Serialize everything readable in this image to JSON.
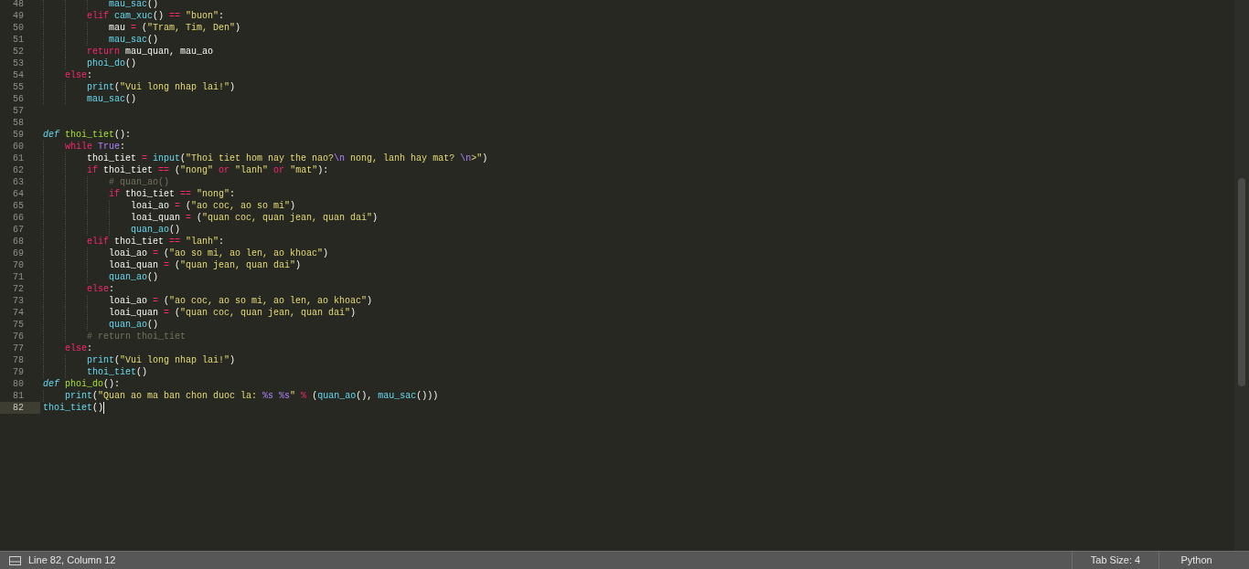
{
  "editor": {
    "lines": [
      {
        "number": "48",
        "current": false,
        "tokens": [
          {
            "kind": "call",
            "text": "            mau_sac"
          },
          {
            "kind": "plain",
            "text": "()"
          }
        ]
      },
      {
        "number": "49",
        "current": false,
        "tokens": [
          {
            "kind": "keyword",
            "text": "        elif "
          },
          {
            "kind": "call",
            "text": "cam_xuc"
          },
          {
            "kind": "plain",
            "text": "() "
          },
          {
            "kind": "operator",
            "text": "== "
          },
          {
            "kind": "string",
            "text": "\"buon\""
          },
          {
            "kind": "plain",
            "text": ":"
          }
        ]
      },
      {
        "number": "50",
        "current": false,
        "tokens": [
          {
            "kind": "plain",
            "text": "            mau "
          },
          {
            "kind": "operator",
            "text": "="
          },
          {
            "kind": "plain",
            "text": " ("
          },
          {
            "kind": "string",
            "text": "\"Tram, Tim, Den\""
          },
          {
            "kind": "plain",
            "text": ")"
          }
        ]
      },
      {
        "number": "51",
        "current": false,
        "tokens": [
          {
            "kind": "call",
            "text": "            mau_sac"
          },
          {
            "kind": "plain",
            "text": "()"
          }
        ]
      },
      {
        "number": "52",
        "current": false,
        "tokens": [
          {
            "kind": "keyword",
            "text": "        return"
          },
          {
            "kind": "plain",
            "text": " mau_quan, mau_ao"
          }
        ]
      },
      {
        "number": "53",
        "current": false,
        "tokens": [
          {
            "kind": "call",
            "text": "        phoi_do"
          },
          {
            "kind": "plain",
            "text": "()"
          }
        ]
      },
      {
        "number": "54",
        "current": false,
        "tokens": [
          {
            "kind": "keyword",
            "text": "    else"
          },
          {
            "kind": "plain",
            "text": ":"
          }
        ]
      },
      {
        "number": "55",
        "current": false,
        "tokens": [
          {
            "kind": "call",
            "text": "        print"
          },
          {
            "kind": "plain",
            "text": "("
          },
          {
            "kind": "string",
            "text": "\"Vui long nhap lai!\""
          },
          {
            "kind": "plain",
            "text": ")"
          }
        ]
      },
      {
        "number": "56",
        "current": false,
        "tokens": [
          {
            "kind": "call",
            "text": "        mau_sac"
          },
          {
            "kind": "plain",
            "text": "()"
          }
        ]
      },
      {
        "number": "57",
        "current": false
      },
      {
        "number": "58",
        "current": false
      },
      {
        "number": "59",
        "current": false,
        "tokens": [
          {
            "kind": "storage",
            "text": "def "
          },
          {
            "kind": "name",
            "text": "thoi_tiet"
          },
          {
            "kind": "plain",
            "text": "():"
          }
        ]
      },
      {
        "number": "60",
        "current": false,
        "tokens": [
          {
            "kind": "keyword",
            "text": "    while "
          },
          {
            "kind": "constant",
            "text": "True"
          },
          {
            "kind": "plain",
            "text": ":"
          }
        ]
      },
      {
        "number": "61",
        "current": false,
        "tokens": [
          {
            "kind": "plain",
            "text": "        thoi_tiet "
          },
          {
            "kind": "operator",
            "text": "= "
          },
          {
            "kind": "call",
            "text": "input"
          },
          {
            "kind": "plain",
            "text": "("
          },
          {
            "kind": "string",
            "text": "\"Thoi tiet hom nay the nao?"
          },
          {
            "kind": "constant",
            "text": "\\n"
          },
          {
            "kind": "string",
            "text": " nong, lanh hay mat? "
          },
          {
            "kind": "constant",
            "text": "\\n"
          },
          {
            "kind": "string",
            "text": ">\""
          },
          {
            "kind": "plain",
            "text": ")"
          }
        ]
      },
      {
        "number": "62",
        "current": false,
        "tokens": [
          {
            "kind": "keyword",
            "text": "        if"
          },
          {
            "kind": "plain",
            "text": " thoi_tiet "
          },
          {
            "kind": "operator",
            "text": "=="
          },
          {
            "kind": "plain",
            "text": " ("
          },
          {
            "kind": "string",
            "text": "\"nong\" "
          },
          {
            "kind": "operator",
            "text": "or "
          },
          {
            "kind": "string",
            "text": "\"lanh\" "
          },
          {
            "kind": "operator",
            "text": "or "
          },
          {
            "kind": "string",
            "text": "\"mat\""
          },
          {
            "kind": "plain",
            "text": "):"
          }
        ]
      },
      {
        "number": "63",
        "current": false,
        "tokens": [
          {
            "kind": "comment",
            "text": "            # quan_ao()"
          }
        ]
      },
      {
        "number": "64",
        "current": false,
        "tokens": [
          {
            "kind": "keyword",
            "text": "            if"
          },
          {
            "kind": "plain",
            "text": " thoi_tiet "
          },
          {
            "kind": "operator",
            "text": "== "
          },
          {
            "kind": "string",
            "text": "\"nong\""
          },
          {
            "kind": "plain",
            "text": ":"
          }
        ]
      },
      {
        "number": "65",
        "current": false,
        "tokens": [
          {
            "kind": "plain",
            "text": "                loai_ao "
          },
          {
            "kind": "operator",
            "text": "="
          },
          {
            "kind": "plain",
            "text": " ("
          },
          {
            "kind": "string",
            "text": "\"ao coc, ao so mi\""
          },
          {
            "kind": "plain",
            "text": ")"
          }
        ]
      },
      {
        "number": "66",
        "current": false,
        "tokens": [
          {
            "kind": "plain",
            "text": "                loai_quan "
          },
          {
            "kind": "operator",
            "text": "="
          },
          {
            "kind": "plain",
            "text": " ("
          },
          {
            "kind": "string",
            "text": "\"quan coc, quan jean, quan dai\""
          },
          {
            "kind": "plain",
            "text": ")"
          }
        ]
      },
      {
        "number": "67",
        "current": false,
        "tokens": [
          {
            "kind": "call",
            "text": "                quan_ao"
          },
          {
            "kind": "plain",
            "text": "()"
          }
        ]
      },
      {
        "number": "68",
        "current": false,
        "tokens": [
          {
            "kind": "keyword",
            "text": "        elif"
          },
          {
            "kind": "plain",
            "text": " thoi_tiet "
          },
          {
            "kind": "operator",
            "text": "== "
          },
          {
            "kind": "string",
            "text": "\"lanh\""
          },
          {
            "kind": "plain",
            "text": ":"
          }
        ]
      },
      {
        "number": "69",
        "current": false,
        "tokens": [
          {
            "kind": "plain",
            "text": "            loai_ao "
          },
          {
            "kind": "operator",
            "text": "="
          },
          {
            "kind": "plain",
            "text": " ("
          },
          {
            "kind": "string",
            "text": "\"ao so mi, ao len, ao khoac\""
          },
          {
            "kind": "plain",
            "text": ")"
          }
        ]
      },
      {
        "number": "70",
        "current": false,
        "tokens": [
          {
            "kind": "plain",
            "text": "            loai_quan "
          },
          {
            "kind": "operator",
            "text": "="
          },
          {
            "kind": "plain",
            "text": " ("
          },
          {
            "kind": "string",
            "text": "\"quan jean, quan dai\""
          },
          {
            "kind": "plain",
            "text": ")"
          }
        ]
      },
      {
        "number": "71",
        "current": false,
        "tokens": [
          {
            "kind": "call",
            "text": "            quan_ao"
          },
          {
            "kind": "plain",
            "text": "()"
          }
        ]
      },
      {
        "number": "72",
        "current": false,
        "tokens": [
          {
            "kind": "keyword",
            "text": "        else"
          },
          {
            "kind": "plain",
            "text": ":"
          }
        ]
      },
      {
        "number": "73",
        "current": false,
        "tokens": [
          {
            "kind": "plain",
            "text": "            loai_ao "
          },
          {
            "kind": "operator",
            "text": "="
          },
          {
            "kind": "plain",
            "text": " ("
          },
          {
            "kind": "string",
            "text": "\"ao coc, ao so mi, ao len, ao khoac\""
          },
          {
            "kind": "plain",
            "text": ")"
          }
        ]
      },
      {
        "number": "74",
        "current": false,
        "tokens": [
          {
            "kind": "plain",
            "text": "            loai_quan "
          },
          {
            "kind": "operator",
            "text": "="
          },
          {
            "kind": "plain",
            "text": " ("
          },
          {
            "kind": "string",
            "text": "\"quan coc, quan jean, quan dai\""
          },
          {
            "kind": "plain",
            "text": ")"
          }
        ]
      },
      {
        "number": "75",
        "current": false,
        "tokens": [
          {
            "kind": "call",
            "text": "            quan_ao"
          },
          {
            "kind": "plain",
            "text": "()"
          }
        ]
      },
      {
        "number": "76",
        "current": false,
        "tokens": [
          {
            "kind": "comment",
            "text": "        # return thoi_tiet"
          }
        ]
      },
      {
        "number": "77",
        "current": false,
        "tokens": [
          {
            "kind": "keyword",
            "text": "    else"
          },
          {
            "kind": "plain",
            "text": ":"
          }
        ]
      },
      {
        "number": "78",
        "current": false,
        "tokens": [
          {
            "kind": "call",
            "text": "        print"
          },
          {
            "kind": "plain",
            "text": "("
          },
          {
            "kind": "string",
            "text": "\"Vui long nhap lai!\""
          },
          {
            "kind": "plain",
            "text": ")"
          }
        ]
      },
      {
        "number": "79",
        "current": false,
        "tokens": [
          {
            "kind": "call",
            "text": "        thoi_tiet"
          },
          {
            "kind": "plain",
            "text": "()"
          }
        ]
      },
      {
        "number": "80",
        "current": false,
        "tokens": [
          {
            "kind": "storage",
            "text": "def "
          },
          {
            "kind": "name",
            "text": "phoi_do"
          },
          {
            "kind": "plain",
            "text": "():"
          }
        ]
      },
      {
        "number": "81",
        "current": false,
        "tokens": [
          {
            "kind": "call",
            "text": "    print"
          },
          {
            "kind": "plain",
            "text": "("
          },
          {
            "kind": "string",
            "text": "\"Quan ao ma ban chon duoc la: "
          },
          {
            "kind": "constant",
            "text": "%s "
          },
          {
            "kind": "constant",
            "text": "%s"
          },
          {
            "kind": "string",
            "text": "\" "
          },
          {
            "kind": "operator",
            "text": "%"
          },
          {
            "kind": "plain",
            "text": " ("
          },
          {
            "kind": "call",
            "text": "quan_ao"
          },
          {
            "kind": "plain",
            "text": "(), "
          },
          {
            "kind": "call",
            "text": "mau_sac"
          },
          {
            "kind": "plain",
            "text": "()))"
          }
        ]
      },
      {
        "number": "82",
        "current": true,
        "tokens": [
          {
            "kind": "call",
            "text": "thoi_tiet"
          },
          {
            "kind": "plain",
            "text": "()"
          }
        ]
      }
    ]
  },
  "status_bar": {
    "position": "Line 82, Column 12",
    "tab_size": "Tab Size: 4",
    "syntax": "Python"
  }
}
